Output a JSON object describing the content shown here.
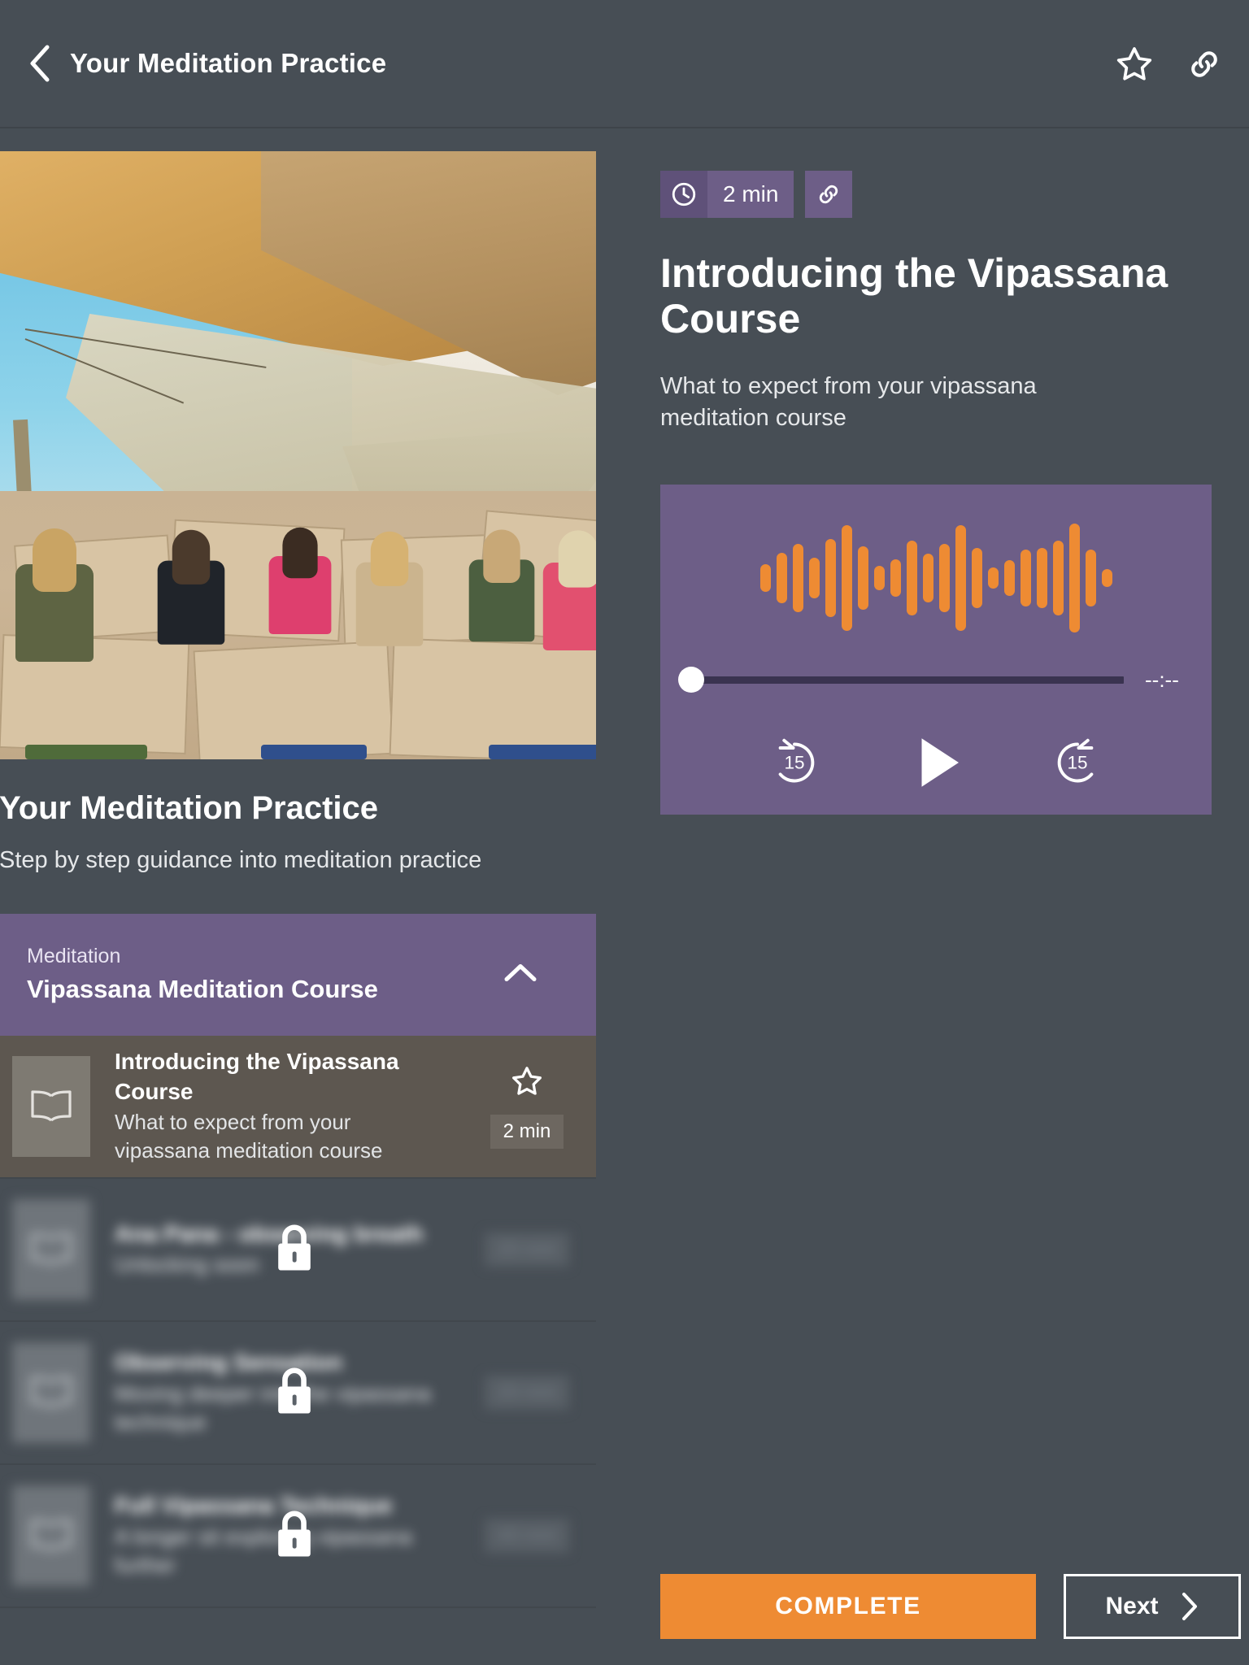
{
  "header": {
    "title": "Your Meditation Practice",
    "back_icon": "chevron-left-icon",
    "favorite_icon": "star-outline-icon",
    "share_icon": "link-icon"
  },
  "hero": {
    "alt": "Group of people seated in meditation under tan shade sails on a stone patio",
    "people_count": 6
  },
  "course": {
    "title": "Your Meditation Practice",
    "subtitle": "Step by step guidance into meditation practice"
  },
  "section": {
    "kicker": "Meditation",
    "name": "Vipassana Meditation Course",
    "collapse_icon": "chevron-up-icon",
    "expanded": true
  },
  "lessons": [
    {
      "title": "Introducing the Vipassana Course",
      "desc": "What to expect from your vipassana meditation course",
      "duration": "2 min",
      "state": "active",
      "thumb_icon": "open-book-icon",
      "favorite_icon": "star-outline-icon"
    },
    {
      "title": "Ana Pana - observing breath",
      "desc": "Unlocking soon",
      "duration": "20 min",
      "state": "locked",
      "thumb_icon": "open-book-icon",
      "lock_icon": "lock-icon"
    },
    {
      "title": "Observing Sensation",
      "desc": "Moving deeper into the vipassana technique",
      "duration": "20 min",
      "state": "locked",
      "thumb_icon": "open-book-icon",
      "lock_icon": "lock-icon"
    },
    {
      "title": "Full Vipassana Technique",
      "desc": "A longer sit exploring vipassana further",
      "duration": "40 min",
      "state": "locked",
      "thumb_icon": "open-book-icon",
      "lock_icon": "lock-icon"
    }
  ],
  "lesson": {
    "duration": "2 min",
    "duration_icon": "clock-icon",
    "share_icon": "link-icon",
    "heading": "Introducing the Vipassana Course",
    "subtitle": "What to expect from your vipassana meditation course"
  },
  "player": {
    "time_remaining": "--:--",
    "progress_percent": 0,
    "play_icon": "play-icon",
    "rewind_label": "15",
    "rewind_icon": "rewind-15-icon",
    "forward_label": "15",
    "forward_icon": "forward-15-icon",
    "waveform_bars": [
      34,
      62,
      84,
      50,
      96,
      130,
      78,
      30,
      46,
      92,
      60,
      84,
      130,
      74,
      26,
      44,
      70,
      74,
      92,
      134,
      70,
      22
    ]
  },
  "footer": {
    "complete_label": "COMPLETE",
    "next_label": "Next",
    "next_icon": "chevron-right-icon"
  },
  "colors": {
    "app_bg": "#474e55",
    "purple": "#6d5e87",
    "purple_dark": "#5f5179",
    "orange": "#ee8b33",
    "active_row": "#5d5750",
    "text": "#ffffff"
  }
}
